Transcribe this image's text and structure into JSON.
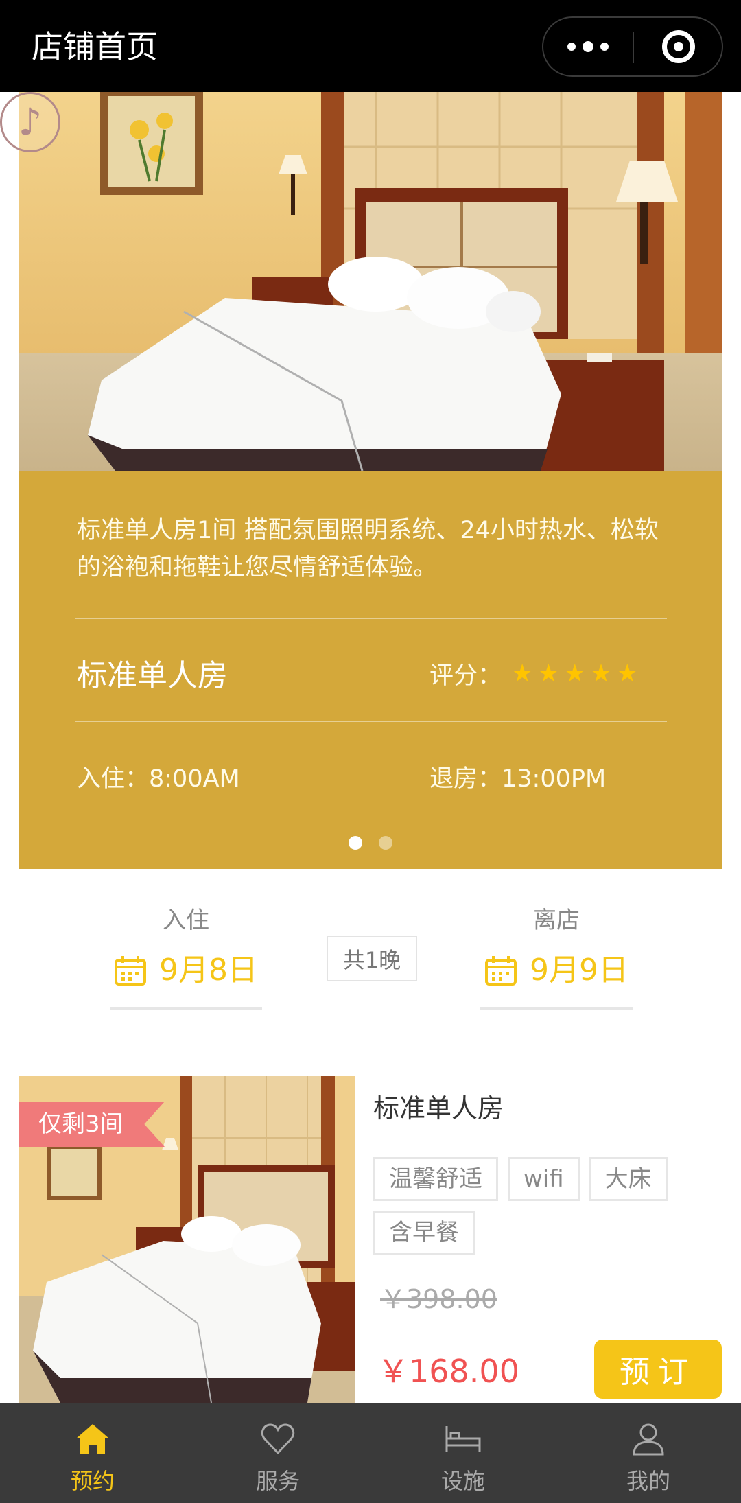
{
  "topbar": {
    "title": "店铺首页",
    "more_icon": "more-dots-icon",
    "close_icon": "target-close-icon"
  },
  "hero": {
    "music_icon": "music-note-icon",
    "description": "标准单人房1间 搭配氛围照明系统、24小时热水、松软的浴袍和拖鞋让您尽情舒适体验。",
    "room_name": "标准单人房",
    "rating_label": "评分：",
    "rating_stars": 5,
    "checkin": "入住：8:00AM",
    "checkout": "退房：13:00PM",
    "slide_count": 2,
    "active_slide": 1
  },
  "dates": {
    "checkin_label": "入住",
    "checkin_date": "9月8日",
    "nights": "共1晚",
    "checkout_label": "离店",
    "checkout_date": "9月9日",
    "calendar_icon": "calendar-icon"
  },
  "room_card": {
    "badge": "仅剩3间",
    "title": "标准单人房",
    "tags": [
      "温馨舒适",
      "wifi",
      "大床",
      "含早餐"
    ],
    "old_price": "￥398.00",
    "price": "￥168.00",
    "book_label": "预订"
  },
  "tabbar": {
    "items": [
      {
        "label": "预约",
        "icon": "home-icon",
        "active": true
      },
      {
        "label": "服务",
        "icon": "heart-icon",
        "active": false
      },
      {
        "label": "设施",
        "icon": "bed-icon",
        "active": false
      },
      {
        "label": "我的",
        "icon": "user-icon",
        "active": false
      }
    ]
  },
  "colors": {
    "gold_panel": "#d4a83a",
    "accent_yellow": "#f5c518",
    "price_red": "#f05252",
    "badge_pink": "#f07a7a",
    "tabbar_bg": "#3a3a3a"
  }
}
